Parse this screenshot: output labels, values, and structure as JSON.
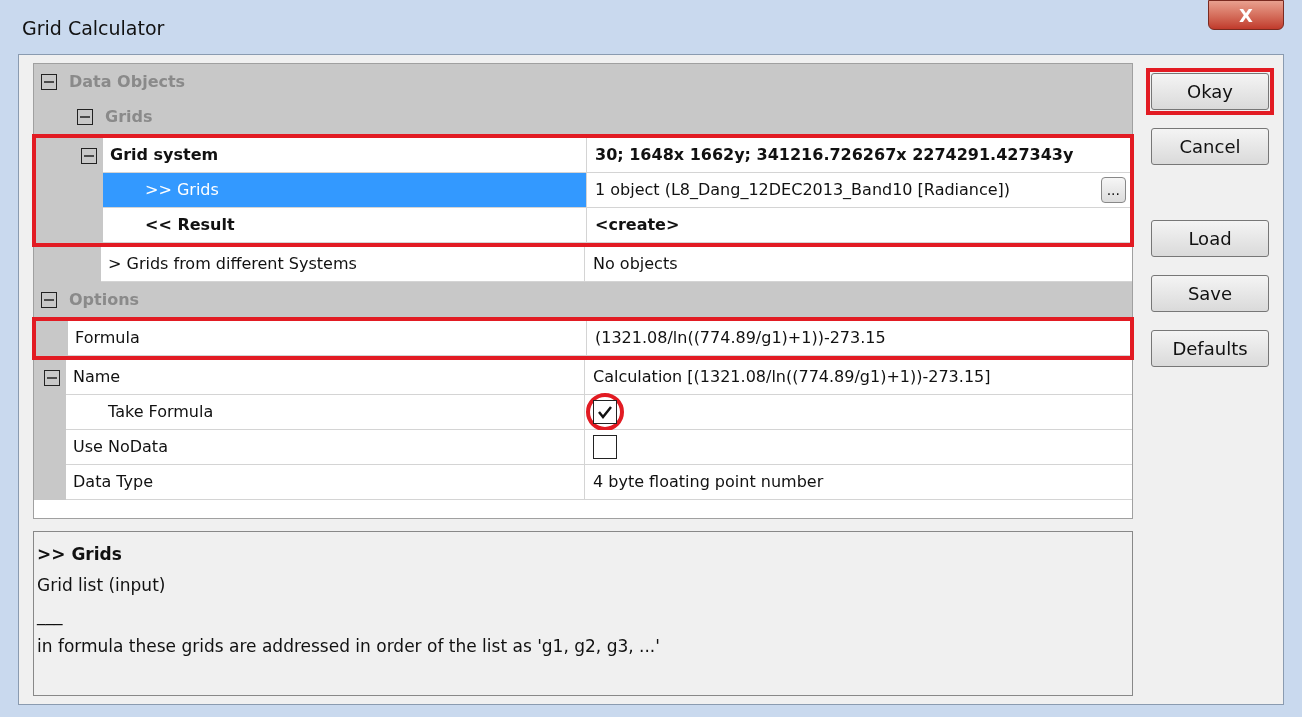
{
  "window": {
    "title": "Grid Calculator",
    "close_label": "X"
  },
  "grid": [
    {
      "kind": "category",
      "label": "Data Objects",
      "expanded": true,
      "children": [
        {
          "kind": "category",
          "label": "Grids",
          "expanded": true,
          "children": [
            {
              "kind": "property",
              "label": "Grid system",
              "value": "30; 1648x 1662y; 341216.726267x 2274291.427343y",
              "bold": true,
              "selected": false,
              "marked": true,
              "expanded": true,
              "children": [
                {
                  "kind": "property",
                  "label": ">> Grids",
                  "value": "1 object (L8_Dang_12DEC2013_Band10 [Radiance])",
                  "button_label": "...",
                  "bold": false,
                  "selected": true
                },
                {
                  "kind": "property",
                  "label": "<< Result",
                  "value": "<create>",
                  "bold": true,
                  "selected": false
                }
              ]
            },
            {
              "kind": "property",
              "label": "> Grids from different Systems",
              "value": "No objects",
              "bold": false,
              "selected": false
            }
          ]
        }
      ]
    },
    {
      "kind": "category",
      "label": "Options",
      "expanded": true,
      "children": [
        {
          "kind": "property",
          "label": "Formula",
          "value": "(1321.08/ln((774.89/g1)+1))-273.15",
          "bold": false,
          "selected": false,
          "marked": true
        },
        {
          "kind": "property",
          "label": "Name",
          "value": "Calculation [(1321.08/ln((774.89/g1)+1))-273.15]",
          "bold": false,
          "selected": false,
          "expanded": true,
          "children": [
            {
              "kind": "checkbox",
              "label": "Take Formula",
              "checked": true,
              "circled": true,
              "selected": false
            }
          ]
        },
        {
          "kind": "checkbox",
          "label": "Use NoData",
          "checked": false,
          "circled": false,
          "selected": false
        },
        {
          "kind": "property",
          "label": "Data Type",
          "value": "4 byte floating point number",
          "bold": false,
          "selected": false
        }
      ]
    }
  ],
  "button_groups": [
    [
      {
        "label": "Okay",
        "marked": true
      },
      {
        "label": "Cancel",
        "marked": false
      }
    ],
    [
      {
        "label": "Load",
        "marked": false
      },
      {
        "label": "Save",
        "marked": false
      },
      {
        "label": "Defaults",
        "marked": false
      }
    ]
  ],
  "description": {
    "title": ">> Grids",
    "lines": [
      "Grid list (input)",
      "___",
      "in formula these grids are addressed in order of the list as 'g1, g2, g3, ...'"
    ]
  }
}
